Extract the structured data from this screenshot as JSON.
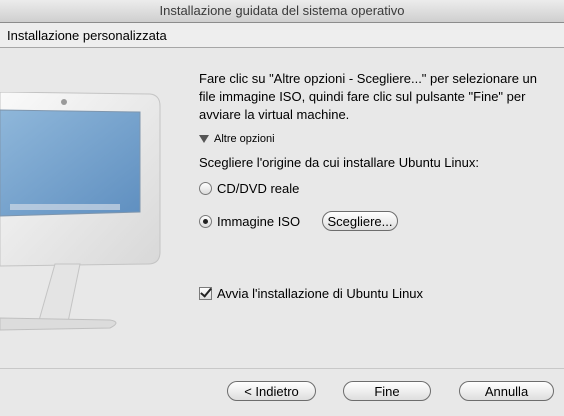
{
  "window": {
    "title": "Installazione guidata del sistema operativo"
  },
  "header": {
    "title": "Installazione personalizzata"
  },
  "main": {
    "description": "Fare clic su \"Altre opzioni - Scegliere...\" per selezionare un file immagine ISO, quindi fare clic sul pulsante \"Fine\" per avviare la virtual machine.",
    "disclosure_label": "Altre opzioni",
    "source_label": "Scegliere l'origine da cui installare Ubuntu Linux:",
    "options": [
      {
        "label": "CD/DVD reale",
        "selected": false
      },
      {
        "label": "Immagine ISO",
        "selected": true
      }
    ],
    "choose_button": "Scegliere...",
    "checkbox": {
      "label": "Avvia l'installazione di Ubuntu Linux",
      "checked": true
    }
  },
  "footer": {
    "back_label": "< Indietro",
    "finish_label": "Fine",
    "cancel_label": "Annulla"
  }
}
